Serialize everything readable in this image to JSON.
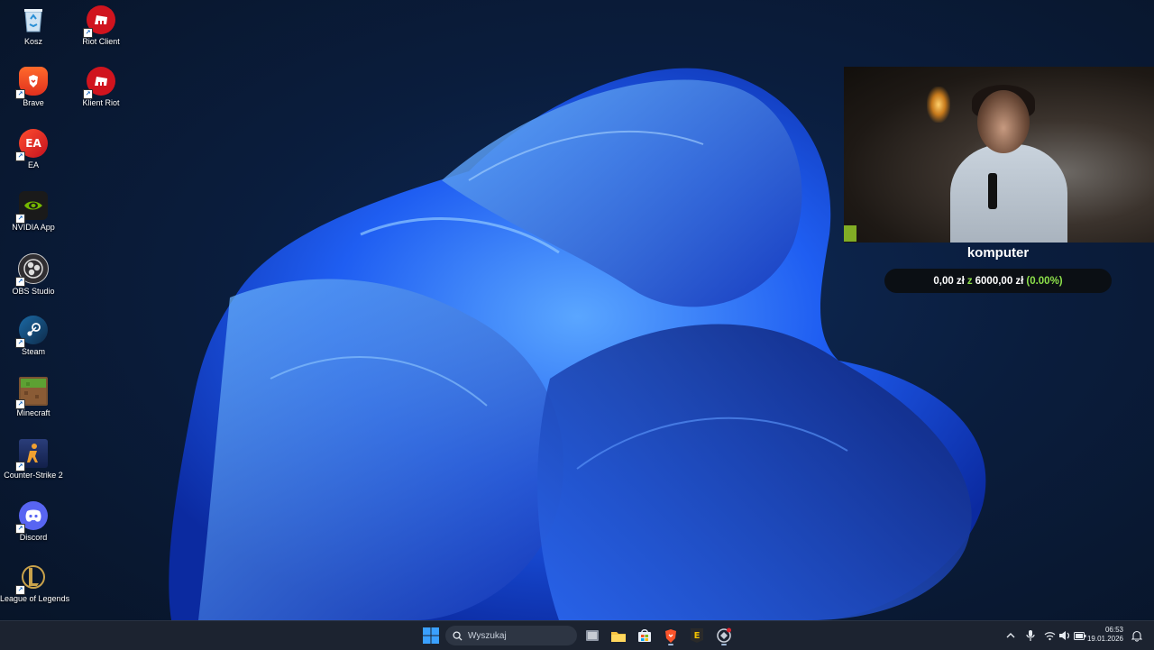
{
  "desktop_icons": [
    {
      "label": "Kosz",
      "icon": "recycle-bin-icon"
    },
    {
      "label": "Riot Client",
      "icon": "riot-client-icon"
    },
    {
      "label": "Brave",
      "icon": "brave-icon"
    },
    {
      "label": "Klient Riot",
      "icon": "riot-client-icon"
    },
    {
      "label": "EA",
      "icon": "ea-icon"
    },
    {
      "label": "NVIDIA App",
      "icon": "nvidia-icon"
    },
    {
      "label": "OBS Studio",
      "icon": "obs-icon"
    },
    {
      "label": "Steam",
      "icon": "steam-icon"
    },
    {
      "label": "Minecraft",
      "icon": "minecraft-icon"
    },
    {
      "label": "Counter-Strike 2",
      "icon": "counter-strike-icon"
    },
    {
      "label": "Discord",
      "icon": "discord-icon"
    },
    {
      "label": "League of Legends",
      "icon": "league-of-legends-icon"
    }
  ],
  "overlay": {
    "title": "komputer",
    "goal_current": "0,00 zł",
    "goal_separator": "z",
    "goal_target": "6000,00 zł",
    "goal_percent": "(0.00%)",
    "goal_progress": 0
  },
  "taskbar": {
    "search_placeholder": "Wyszukaj",
    "pinned": [
      "windows-start-icon",
      "task-view-icon",
      "file-explorer-icon",
      "microsoft-store-icon",
      "brave-icon",
      "epic-games-icon",
      "riot-client-icon"
    ],
    "time": "06:53",
    "date": "19.01.2026"
  },
  "colors": {
    "goal_accent": "#8de04a",
    "wallpaper_primary": "#1f4fe0",
    "taskbar_bg": "#1c2330"
  }
}
